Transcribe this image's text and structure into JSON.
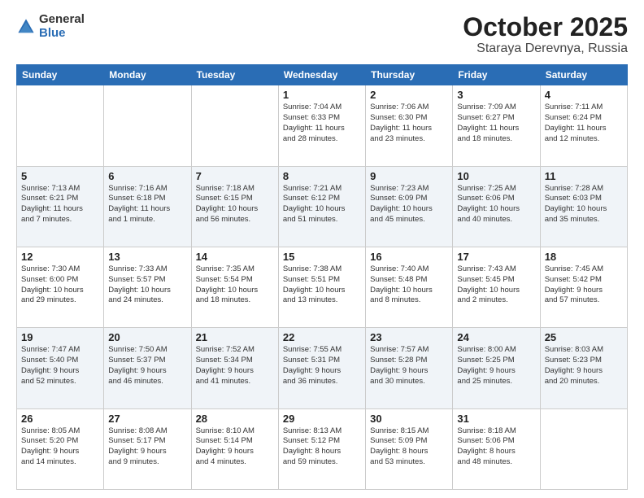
{
  "logo": {
    "general": "General",
    "blue": "Blue"
  },
  "title": "October 2025",
  "location": "Staraya Derevnya, Russia",
  "days_of_week": [
    "Sunday",
    "Monday",
    "Tuesday",
    "Wednesday",
    "Thursday",
    "Friday",
    "Saturday"
  ],
  "weeks": [
    [
      {
        "day": "",
        "info": ""
      },
      {
        "day": "",
        "info": ""
      },
      {
        "day": "",
        "info": ""
      },
      {
        "day": "1",
        "info": "Sunrise: 7:04 AM\nSunset: 6:33 PM\nDaylight: 11 hours\nand 28 minutes."
      },
      {
        "day": "2",
        "info": "Sunrise: 7:06 AM\nSunset: 6:30 PM\nDaylight: 11 hours\nand 23 minutes."
      },
      {
        "day": "3",
        "info": "Sunrise: 7:09 AM\nSunset: 6:27 PM\nDaylight: 11 hours\nand 18 minutes."
      },
      {
        "day": "4",
        "info": "Sunrise: 7:11 AM\nSunset: 6:24 PM\nDaylight: 11 hours\nand 12 minutes."
      }
    ],
    [
      {
        "day": "5",
        "info": "Sunrise: 7:13 AM\nSunset: 6:21 PM\nDaylight: 11 hours\nand 7 minutes."
      },
      {
        "day": "6",
        "info": "Sunrise: 7:16 AM\nSunset: 6:18 PM\nDaylight: 11 hours\nand 1 minute."
      },
      {
        "day": "7",
        "info": "Sunrise: 7:18 AM\nSunset: 6:15 PM\nDaylight: 10 hours\nand 56 minutes."
      },
      {
        "day": "8",
        "info": "Sunrise: 7:21 AM\nSunset: 6:12 PM\nDaylight: 10 hours\nand 51 minutes."
      },
      {
        "day": "9",
        "info": "Sunrise: 7:23 AM\nSunset: 6:09 PM\nDaylight: 10 hours\nand 45 minutes."
      },
      {
        "day": "10",
        "info": "Sunrise: 7:25 AM\nSunset: 6:06 PM\nDaylight: 10 hours\nand 40 minutes."
      },
      {
        "day": "11",
        "info": "Sunrise: 7:28 AM\nSunset: 6:03 PM\nDaylight: 10 hours\nand 35 minutes."
      }
    ],
    [
      {
        "day": "12",
        "info": "Sunrise: 7:30 AM\nSunset: 6:00 PM\nDaylight: 10 hours\nand 29 minutes."
      },
      {
        "day": "13",
        "info": "Sunrise: 7:33 AM\nSunset: 5:57 PM\nDaylight: 10 hours\nand 24 minutes."
      },
      {
        "day": "14",
        "info": "Sunrise: 7:35 AM\nSunset: 5:54 PM\nDaylight: 10 hours\nand 18 minutes."
      },
      {
        "day": "15",
        "info": "Sunrise: 7:38 AM\nSunset: 5:51 PM\nDaylight: 10 hours\nand 13 minutes."
      },
      {
        "day": "16",
        "info": "Sunrise: 7:40 AM\nSunset: 5:48 PM\nDaylight: 10 hours\nand 8 minutes."
      },
      {
        "day": "17",
        "info": "Sunrise: 7:43 AM\nSunset: 5:45 PM\nDaylight: 10 hours\nand 2 minutes."
      },
      {
        "day": "18",
        "info": "Sunrise: 7:45 AM\nSunset: 5:42 PM\nDaylight: 9 hours\nand 57 minutes."
      }
    ],
    [
      {
        "day": "19",
        "info": "Sunrise: 7:47 AM\nSunset: 5:40 PM\nDaylight: 9 hours\nand 52 minutes."
      },
      {
        "day": "20",
        "info": "Sunrise: 7:50 AM\nSunset: 5:37 PM\nDaylight: 9 hours\nand 46 minutes."
      },
      {
        "day": "21",
        "info": "Sunrise: 7:52 AM\nSunset: 5:34 PM\nDaylight: 9 hours\nand 41 minutes."
      },
      {
        "day": "22",
        "info": "Sunrise: 7:55 AM\nSunset: 5:31 PM\nDaylight: 9 hours\nand 36 minutes."
      },
      {
        "day": "23",
        "info": "Sunrise: 7:57 AM\nSunset: 5:28 PM\nDaylight: 9 hours\nand 30 minutes."
      },
      {
        "day": "24",
        "info": "Sunrise: 8:00 AM\nSunset: 5:25 PM\nDaylight: 9 hours\nand 25 minutes."
      },
      {
        "day": "25",
        "info": "Sunrise: 8:03 AM\nSunset: 5:23 PM\nDaylight: 9 hours\nand 20 minutes."
      }
    ],
    [
      {
        "day": "26",
        "info": "Sunrise: 8:05 AM\nSunset: 5:20 PM\nDaylight: 9 hours\nand 14 minutes."
      },
      {
        "day": "27",
        "info": "Sunrise: 8:08 AM\nSunset: 5:17 PM\nDaylight: 9 hours\nand 9 minutes."
      },
      {
        "day": "28",
        "info": "Sunrise: 8:10 AM\nSunset: 5:14 PM\nDaylight: 9 hours\nand 4 minutes."
      },
      {
        "day": "29",
        "info": "Sunrise: 8:13 AM\nSunset: 5:12 PM\nDaylight: 8 hours\nand 59 minutes."
      },
      {
        "day": "30",
        "info": "Sunrise: 8:15 AM\nSunset: 5:09 PM\nDaylight: 8 hours\nand 53 minutes."
      },
      {
        "day": "31",
        "info": "Sunrise: 8:18 AM\nSunset: 5:06 PM\nDaylight: 8 hours\nand 48 minutes."
      },
      {
        "day": "",
        "info": ""
      }
    ]
  ]
}
